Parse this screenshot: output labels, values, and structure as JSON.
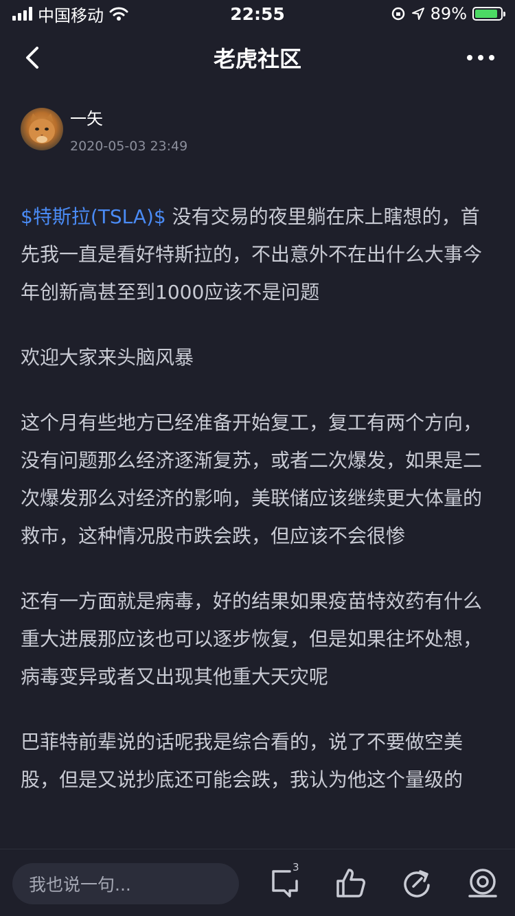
{
  "status_bar": {
    "carrier": "中国移动",
    "time": "22:55",
    "battery_percent": "89%",
    "battery_level": 0.89
  },
  "nav": {
    "title": "老虎社区"
  },
  "author": {
    "name": "一矢",
    "date": "2020-05-03 23:49"
  },
  "post": {
    "ticker": "$特斯拉(TSLA)$",
    "p1_text": " 没有交易的夜里躺在床上瞎想的，首先我一直是看好特斯拉的，不出意外不在出什么大事今年创新高甚至到1000应该不是问题",
    "p2": "欢迎大家来头脑风暴",
    "p3": "这个月有些地方已经准备开始复工，复工有两个方向，没有问题那么经济逐渐复苏，或者二次爆发，如果是二次爆发那么对经济的影响，美联储应该继续更大体量的救市，这种情况股市跌会跌，但应该不会很惨",
    "p4": "还有一方面就是病毒，好的结果如果疫苗特效药有什么重大进展那应该也可以逐步恢复，但是如果往坏处想，病毒变异或者又出现其他重大天灾呢",
    "p5": "巴菲特前辈说的话呢我是综合看的，说了不要做空美股，但是又说抄底还可能会跌，我认为他这个量级的"
  },
  "bottom_bar": {
    "comment_placeholder": "我也说一句...",
    "comment_count": "3",
    "icons": [
      "comment-icon",
      "like-icon",
      "share-icon",
      "eye-icon"
    ]
  },
  "colors": {
    "background": "#1e1f2a",
    "text": "#c9cbd4",
    "accent_link": "#4a8bf5",
    "battery": "#4cd964"
  }
}
